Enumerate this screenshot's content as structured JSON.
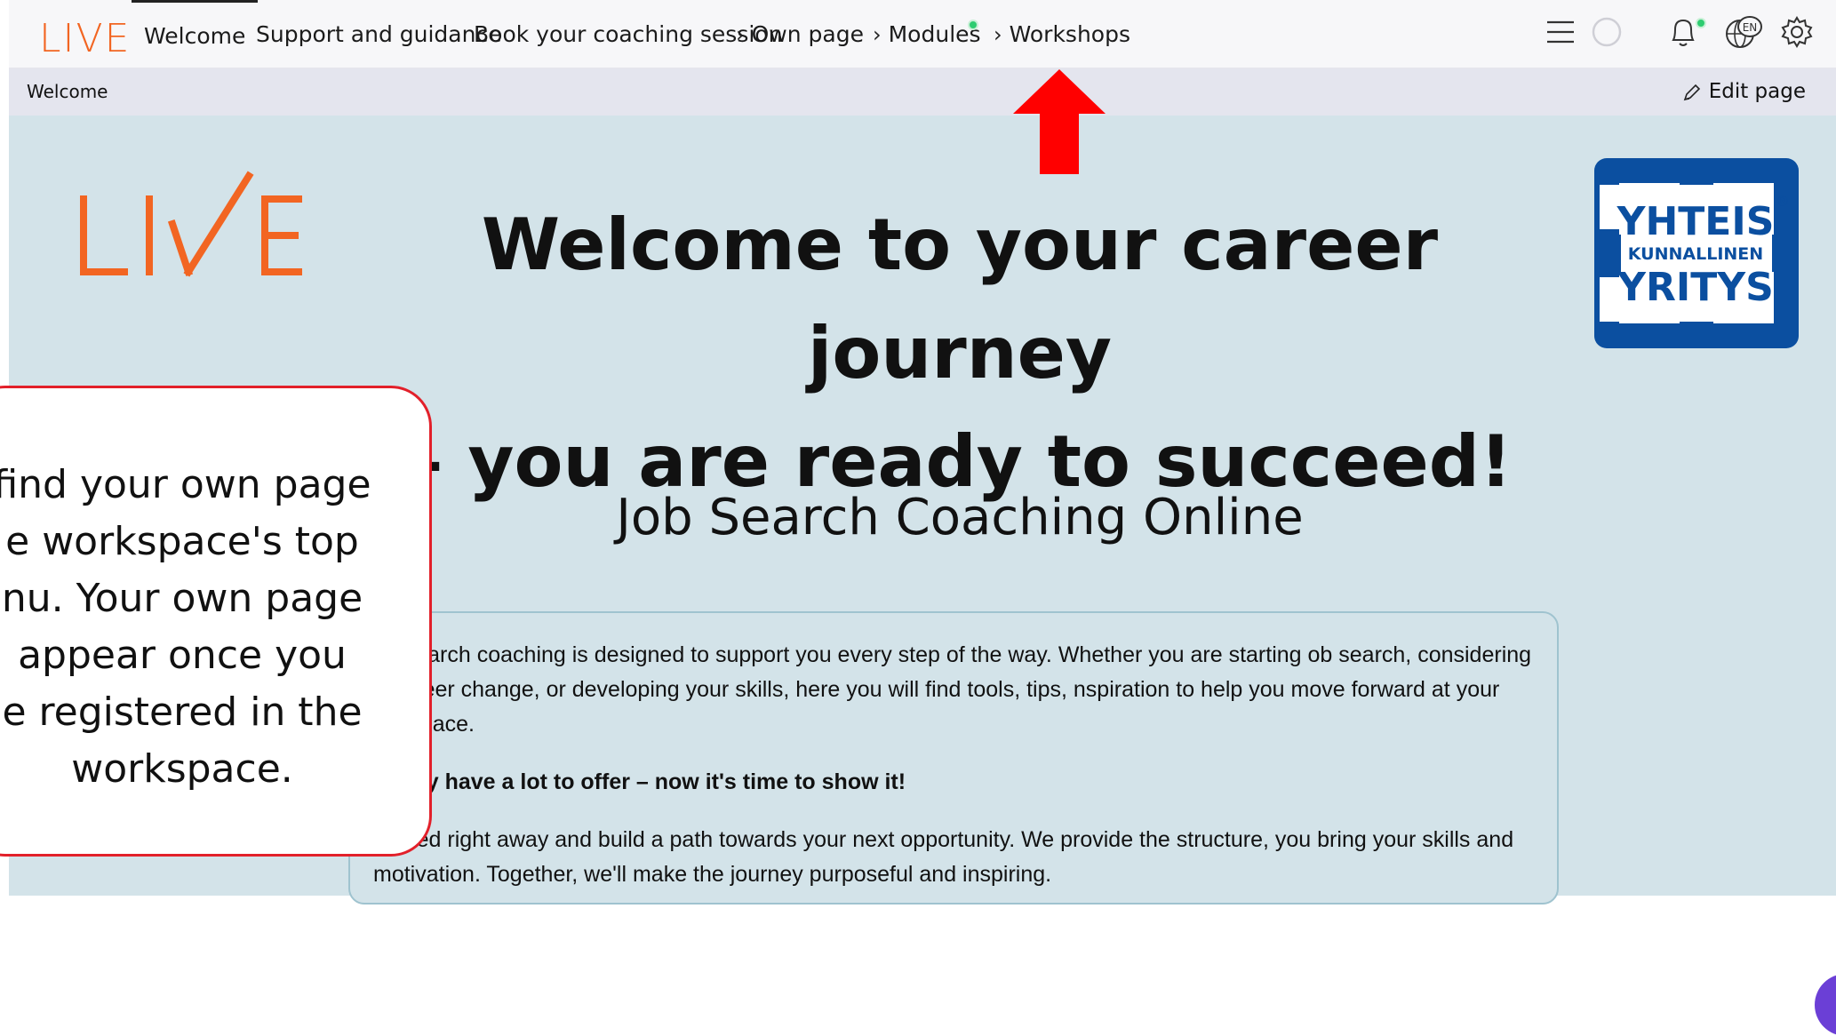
{
  "brand": {
    "logo_text": "LIVE",
    "accent": "#f26522"
  },
  "nav": {
    "items": [
      {
        "label": "Welcome",
        "active": true
      },
      {
        "label": "Support and guidance"
      },
      {
        "label": "Book your coaching session"
      },
      {
        "label": "Own page",
        "chevron": true
      },
      {
        "label": "Modules",
        "chevron": true,
        "dot": true
      },
      {
        "label": "Workshops",
        "chevron": true
      }
    ],
    "icons": [
      "hamburger-menu-icon",
      "loading-circle-icon",
      "bell-icon",
      "language-globe-icon",
      "gear-icon"
    ],
    "language_code": "EN"
  },
  "breadcrumb": {
    "current": "Welcome",
    "edit_label": "Edit page"
  },
  "hero": {
    "title_line1": "Welcome to your career journey",
    "title_line2": "– you are ready to succeed!",
    "subtitle": "Job Search Coaching Online"
  },
  "badge": {
    "line1": "YHTEIS",
    "line2": "KUNNALLINEN",
    "line3": "YRITYS",
    "mark": "®",
    "color": "#0b4fa0"
  },
  "info": {
    "p1": "ob search coaching is designed to support you every step of the way. Whether you are starting ob search, considering a career change, or developing your skills, here you will find tools, tips, nspiration to help you move forward at your own pace.",
    "p2": "lready have a lot to offer – now it's time to show it!",
    "p3": "started right away and build a path towards your next opportunity. We provide the structure, you bring your skills and motivation. Together, we'll make the journey purposeful and inspiring."
  },
  "callout": {
    "lines": [
      "find your own page",
      "e workspace's top",
      "nu. Your own page",
      "appear once you",
      "e registered in the",
      "workspace."
    ],
    "border_color": "#e2202a"
  }
}
